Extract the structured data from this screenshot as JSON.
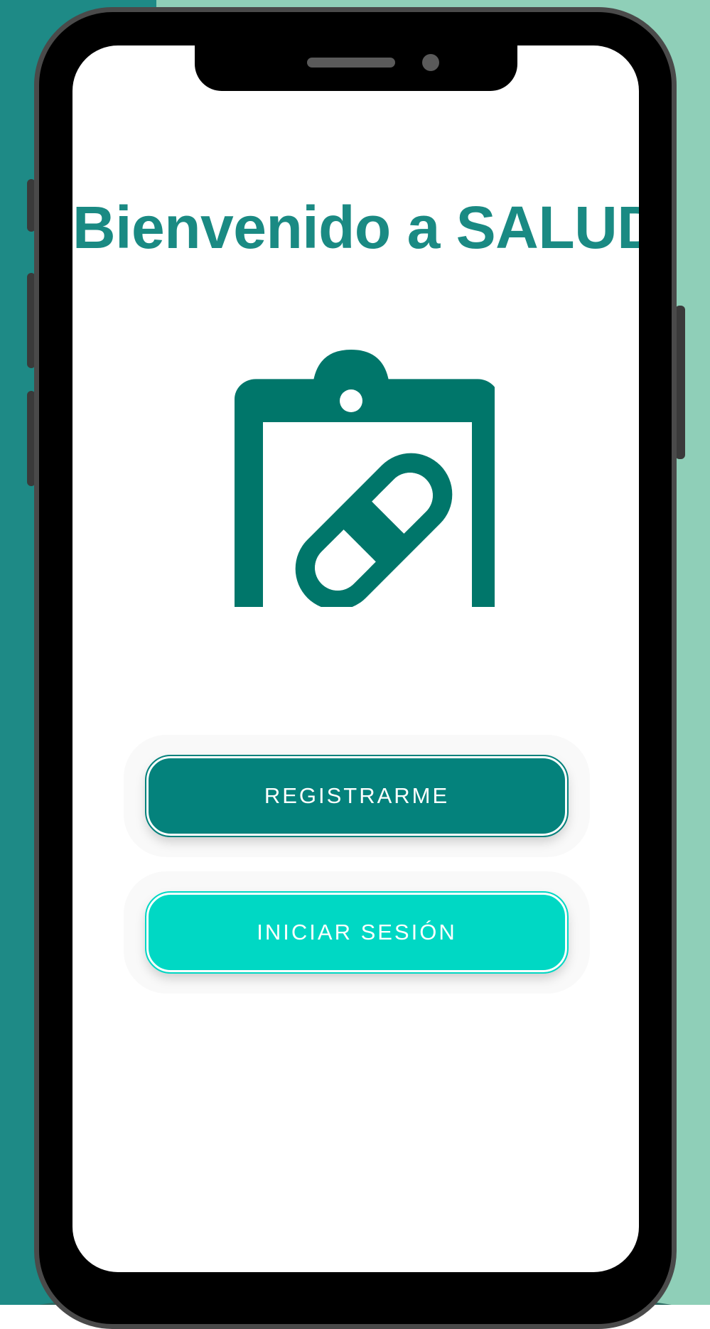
{
  "app": {
    "title": "Bienvenido a SALUD+",
    "logo_icon": "clipboard-pill-icon",
    "accent_color": "#04827c",
    "secondary_color": "#00d8c4",
    "icon_color": "#00766a"
  },
  "actions": {
    "register_label": "REGISTRARME",
    "login_label": "INICIAR SESIÓN"
  }
}
